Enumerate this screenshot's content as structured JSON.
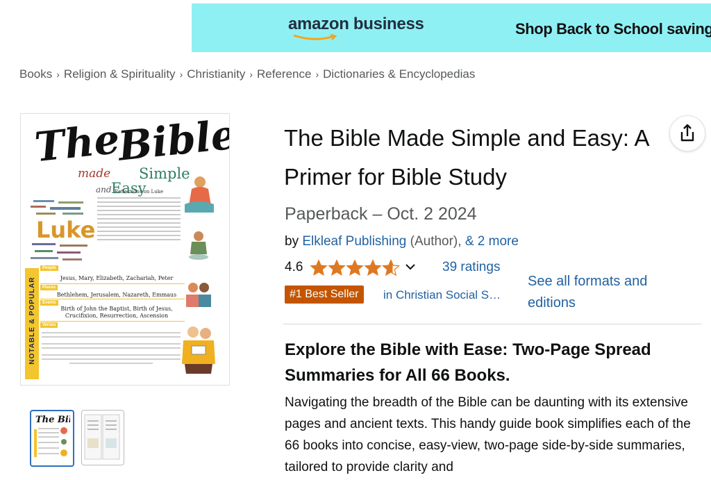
{
  "banner": {
    "brand": "amazon business",
    "cta": "Shop Back to School saving",
    "colors": {
      "background": "#8ff0f4",
      "smile": "#f7a21b"
    }
  },
  "breadcrumb": [
    "Books",
    "Religion & Spirituality",
    "Christianity",
    "Reference",
    "Dictionaries & Encyclopedias"
  ],
  "product": {
    "title": "The Bible Made Simple and Easy: A Primer for Bible Study",
    "format": "Paperback – Oct. 2 2024",
    "by_prefix": "by ",
    "author": "Elkleaf Publishing",
    "author_role": " (Author), ",
    "more_contributors": "& 2 more",
    "rating_value": "4.6",
    "rating_stars": 4.6,
    "ratings_count": "39 ratings",
    "badge": "#1 Best Seller",
    "badge_category": "in Christian Social S…",
    "formats_link": "See all formats and editions",
    "heading": "Explore the Bible with Ease: Two-Page Spread Summaries for All 66 Books.",
    "description": "Navigating the breadth of the Bible can be daunting with its extensive pages and ancient texts. This handy guide book simplifies each of the 66 books into concise, easy-view, two-page side-by-side summaries, tailored to provide clarity and"
  },
  "cover": {
    "line1a": "The",
    "line1b": "Bible",
    "made": "made",
    "simple": "Simple",
    "and": "and",
    "easy": "Easy",
    "book": "Luke",
    "section_title": "Reflections on Luke",
    "side_band": "NOTABLE & POPULAR",
    "rows": [
      {
        "label": "People",
        "text": "Jesus, Mary, Elizabeth, Zachariah, Peter"
      },
      {
        "label": "Places",
        "text": "Bethlehem, Jerusalem, Nazareth, Emmaus"
      },
      {
        "label": "Events",
        "text": "Birth of John the Baptist, Birth of Jesus, Crucifixion, Resurrection, Ascension"
      },
      {
        "label": "Verses",
        "text": ""
      }
    ]
  },
  "icons": {
    "share": "share-icon",
    "chevron": "chevron-down-icon",
    "star": "star-icon"
  },
  "colors": {
    "link": "#2162a1",
    "badge": "#c45500",
    "star": "#de7921"
  }
}
